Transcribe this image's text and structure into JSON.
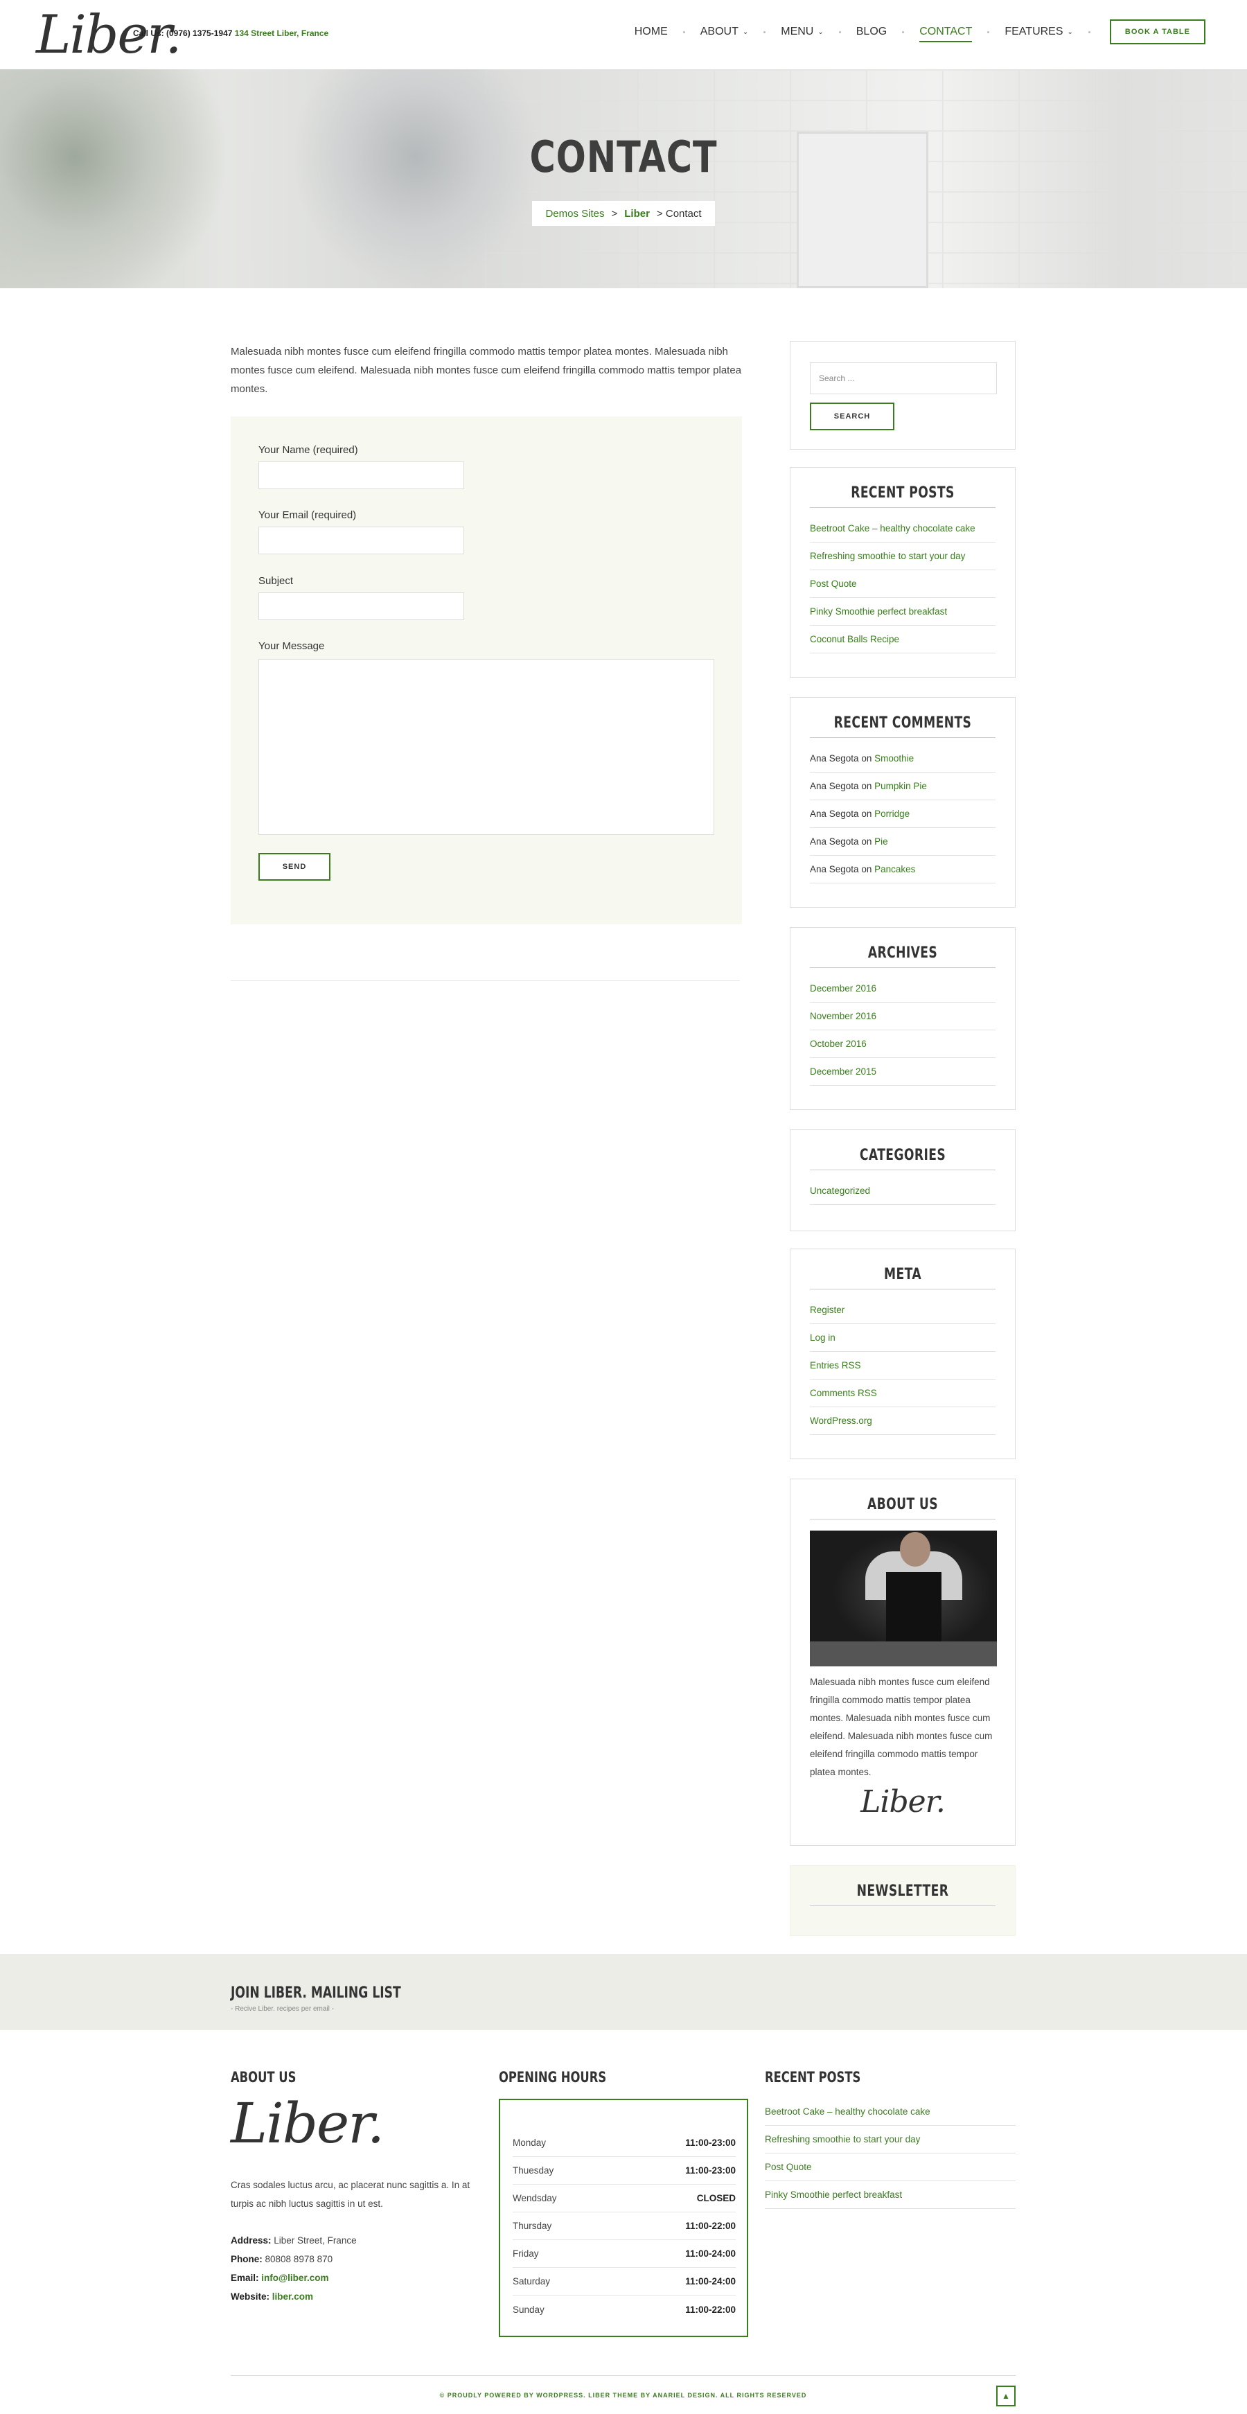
{
  "header": {
    "logo": "Liber.",
    "call_label": "Call Us: (0976) 1375-1947",
    "address": "134 Street Liber, France",
    "nav": [
      {
        "label": "HOME"
      },
      {
        "label": "ABOUT",
        "dropdown": true
      },
      {
        "label": "MENU",
        "dropdown": true
      },
      {
        "label": "BLOG"
      },
      {
        "label": "CONTACT",
        "active": true
      },
      {
        "label": "FEATURES",
        "dropdown": true
      }
    ],
    "book_button": "BOOK A TABLE"
  },
  "hero": {
    "title": "CONTACT",
    "breadcrumb": {
      "home": "Demos Sites",
      "sep1": ">",
      "site": "Liber",
      "sep2": ">",
      "current": "Contact"
    }
  },
  "content": {
    "intro": "Malesuada nibh montes fusce cum eleifend fringilla commodo mattis tempor platea montes. Malesuada nibh montes fusce cum eleifend. Malesuada nibh montes fusce cum eleifend fringilla commodo mattis tempor platea montes.",
    "form": {
      "name_label": "Your Name (required)",
      "email_label": "Your Email (required)",
      "subject_label": "Subject",
      "message_label": "Your Message",
      "send_button": "SEND"
    }
  },
  "sidebar": {
    "search": {
      "placeholder": "Search ...",
      "button": "SEARCH"
    },
    "recent_posts": {
      "title": "RECENT POSTS",
      "items": [
        "Beetroot Cake – healthy chocolate cake",
        "Refreshing smoothie to start your day",
        "Post Quote",
        "Pinky Smoothie perfect breakfast",
        "Coconut Balls Recipe"
      ]
    },
    "recent_comments": {
      "title": "RECENT COMMENTS",
      "items": [
        {
          "author": "Ana Segota",
          "on": "on",
          "post": "Smoothie"
        },
        {
          "author": "Ana Segota",
          "on": "on",
          "post": "Pumpkin Pie"
        },
        {
          "author": "Ana Segota",
          "on": "on",
          "post": "Porridge"
        },
        {
          "author": "Ana Segota",
          "on": "on",
          "post": "Pie"
        },
        {
          "author": "Ana Segota",
          "on": "on",
          "post": "Pancakes"
        }
      ]
    },
    "archives": {
      "title": "ARCHIVES",
      "items": [
        "December 2016",
        "November 2016",
        "October 2016",
        "December 2015"
      ]
    },
    "categories": {
      "title": "CATEGORIES",
      "items": [
        "Uncategorized"
      ]
    },
    "meta": {
      "title": "META",
      "items": [
        "Register",
        "Log in",
        "Entries RSS",
        "Comments RSS",
        "WordPress.org"
      ]
    },
    "about": {
      "title": "ABOUT US",
      "text": "Malesuada nibh montes fusce cum eleifend fringilla commodo mattis tempor platea montes. Malesuada nibh montes fusce cum eleifend. Malesuada nibh montes fusce cum eleifend fringilla commodo mattis tempor platea montes.",
      "signature": "Liber."
    },
    "newsletter": {
      "title": "NEWSLETTER"
    }
  },
  "mailing": {
    "title": "JOIN LIBER. MAILING LIST",
    "subtitle": "- Recive Liber. recipes per email -"
  },
  "footer": {
    "about": {
      "title": "ABOUT US",
      "logo": "Liber.",
      "text": "Cras sodales luctus arcu, ac placerat nunc sagittis a. In at turpis ac nibh luctus sagittis in ut est.",
      "address_label": "Address:",
      "address": "Liber Street, France",
      "phone_label": "Phone:",
      "phone": "80808 8978 870",
      "email_label": "Email:",
      "email": "info@liber.com",
      "website_label": "Website:",
      "website": "liber.com"
    },
    "hours": {
      "title": "OPENING HOURS",
      "rows": [
        {
          "day": "Monday",
          "time": "11:00-23:00"
        },
        {
          "day": "Thuesday",
          "time": "11:00-23:00"
        },
        {
          "day": "Wendsday",
          "time": "CLOSED"
        },
        {
          "day": "Thursday",
          "time": "11:00-22:00"
        },
        {
          "day": "Friday",
          "time": "11:00-24:00"
        },
        {
          "day": "Saturday",
          "time": "11:00-24:00"
        },
        {
          "day": "Sunday",
          "time": "11:00-22:00"
        }
      ]
    },
    "recent_posts": {
      "title": "RECENT POSTS",
      "items": [
        "Beetroot Cake – healthy chocolate cake",
        "Refreshing smoothie to start your day",
        "Post Quote",
        "Pinky Smoothie perfect breakfast"
      ]
    },
    "copyright": "© PROUDLY POWERED BY WORDPRESS. LIBER THEME BY ANARIEL DESIGN. ALL RIGHTS RESERVED",
    "to_top_icon": "arrow-up-icon"
  }
}
